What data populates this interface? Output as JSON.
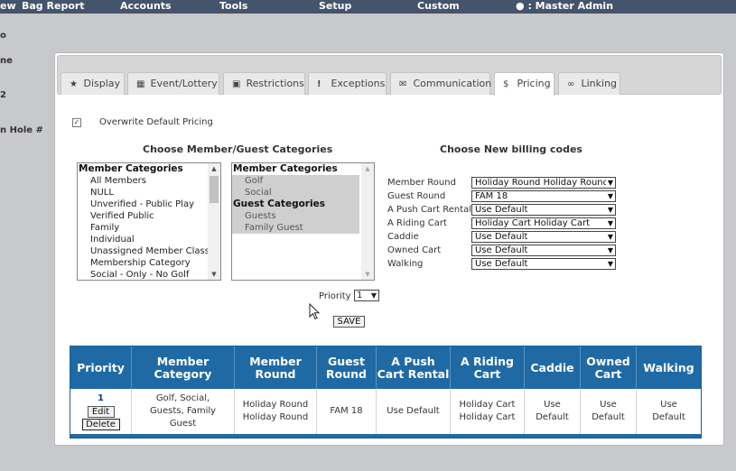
{
  "nav": {
    "items": [
      "ew",
      "Bag Report",
      "Accounts",
      "Tools",
      "Setup",
      "Custom"
    ],
    "user": ": Master Admin"
  },
  "sidebar": [
    "o",
    "ne",
    "2",
    "n Hole #"
  ],
  "tabs": [
    {
      "label": "Display",
      "icon": "star-icon"
    },
    {
      "label": "Event/Lottery",
      "icon": "calendar-icon"
    },
    {
      "label": "Restrictions",
      "icon": "lock-icon"
    },
    {
      "label": "Exceptions",
      "icon": "exclamation-icon"
    },
    {
      "label": "Communication",
      "icon": "envelope-icon"
    },
    {
      "label": "Pricing",
      "icon": "dollar-icon",
      "active": true
    },
    {
      "label": "Linking",
      "icon": "link-icon"
    }
  ],
  "overwrite": {
    "checked": true,
    "label": "Overwrite Default Pricing"
  },
  "categories_heading": "Choose Member/Guest Categories",
  "billing_heading": "Choose New billing codes",
  "left_list": {
    "group": "Member Categories",
    "items": [
      "All Members",
      "NULL",
      "Unverified - Public Play",
      "Verified Public",
      "Family",
      "Individual",
      "Unassigned Member Class",
      "Membership Category",
      "Social - Only - No Golf"
    ]
  },
  "right_list": {
    "groups": [
      {
        "label": "Member Categories",
        "items": [
          "Golf",
          "Social"
        ]
      },
      {
        "label": "Guest Categories",
        "items": [
          "Guests",
          "Family Guest"
        ]
      }
    ]
  },
  "billing": [
    {
      "label": "Member Round",
      "value": "Holiday Round Holiday Round"
    },
    {
      "label": "Guest Round",
      "value": "FAM 18"
    },
    {
      "label": "A Push Cart Rental",
      "value": "Use Default"
    },
    {
      "label": "A Riding Cart",
      "value": "Holiday Cart Holiday Cart"
    },
    {
      "label": "Caddie",
      "value": "Use Default"
    },
    {
      "label": "Owned Cart",
      "value": "Use Default"
    },
    {
      "label": "Walking",
      "value": "Use Default"
    }
  ],
  "priority": {
    "label": "Priority",
    "value": "1"
  },
  "save_label": "SAVE",
  "table": {
    "headers": [
      "Priority",
      "Member Category",
      "Member Round",
      "Guest Round",
      "A Push Cart Rental",
      "A Riding Cart",
      "Caddie",
      "Owned Cart",
      "Walking"
    ],
    "row": {
      "priority": "1",
      "edit_label": "Edit",
      "delete_label": "Delete",
      "member_category": "Golf, Social, Guests, Family Guest",
      "member_round": "Holiday Round Holiday Round",
      "guest_round": "FAM 18",
      "push_cart": "Use Default",
      "riding_cart": "Holiday Cart Holiday Cart",
      "caddie": "Use Default",
      "owned_cart": "Use Default",
      "walking": "Use Default"
    }
  }
}
